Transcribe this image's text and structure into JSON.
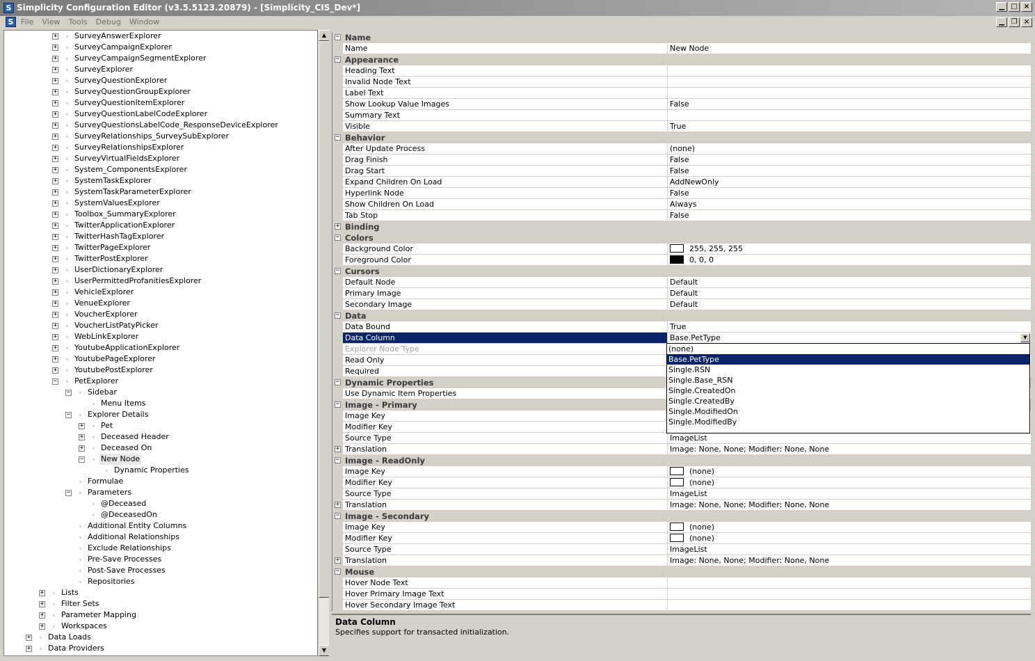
{
  "window": {
    "title": "Simplicity Configuration Editor (v3.5.5123.20879) - [Simplicity_CIS_Dev*]",
    "app_icon": "S",
    "minimize": "▁",
    "maximize": "□",
    "close": "×",
    "restore": "❐"
  },
  "menu": [
    "File",
    "View",
    "Tools",
    "Debug",
    "Window"
  ],
  "tree": [
    {
      "indent": 2,
      "exp": "+",
      "label": "SurveyAnswerExplorer"
    },
    {
      "indent": 2,
      "exp": "+",
      "label": "SurveyCampaignExplorer"
    },
    {
      "indent": 2,
      "exp": "+",
      "label": "SurveyCampaignSegmentExplorer"
    },
    {
      "indent": 2,
      "exp": "+",
      "label": "SurveyExplorer"
    },
    {
      "indent": 2,
      "exp": "+",
      "label": "SurveyQuestionExplorer"
    },
    {
      "indent": 2,
      "exp": "+",
      "label": "SurveyQuestionGroupExplorer"
    },
    {
      "indent": 2,
      "exp": "+",
      "label": "SurveyQuestionItemExplorer"
    },
    {
      "indent": 2,
      "exp": "+",
      "label": "SurveyQuestionLabelCodeExplorer"
    },
    {
      "indent": 2,
      "exp": "+",
      "label": "SurveyQuestionsLabelCode_ResponseDeviceExplorer"
    },
    {
      "indent": 2,
      "exp": "+",
      "label": "SurveyRelationships_SurveySubExplorer"
    },
    {
      "indent": 2,
      "exp": "+",
      "label": "SurveyRelationshipsExplorer"
    },
    {
      "indent": 2,
      "exp": "+",
      "label": "SurveyVirtualFieldsExplorer"
    },
    {
      "indent": 2,
      "exp": "+",
      "label": "System_ComponentsExplorer"
    },
    {
      "indent": 2,
      "exp": "+",
      "label": "SystemTaskExplorer"
    },
    {
      "indent": 2,
      "exp": "+",
      "label": "SystemTaskParameterExplorer"
    },
    {
      "indent": 2,
      "exp": "+",
      "label": "SystemValuesExplorer"
    },
    {
      "indent": 2,
      "exp": "+",
      "label": "Toolbox_SummaryExplorer"
    },
    {
      "indent": 2,
      "exp": "+",
      "label": "TwitterApplicationExplorer"
    },
    {
      "indent": 2,
      "exp": "+",
      "label": "TwitterHashTagExplorer"
    },
    {
      "indent": 2,
      "exp": "+",
      "label": "TwitterPageExplorer"
    },
    {
      "indent": 2,
      "exp": "+",
      "label": "TwitterPostExplorer"
    },
    {
      "indent": 2,
      "exp": "+",
      "label": "UserDictionaryExplorer"
    },
    {
      "indent": 2,
      "exp": "+",
      "label": "UserPermittedProfanitiesExplorer"
    },
    {
      "indent": 2,
      "exp": "+",
      "label": "VehicleExplorer"
    },
    {
      "indent": 2,
      "exp": "+",
      "label": "VenueExplorer"
    },
    {
      "indent": 2,
      "exp": "+",
      "label": "VoucherExplorer"
    },
    {
      "indent": 2,
      "exp": "+",
      "label": "VoucherListPatyPicker"
    },
    {
      "indent": 2,
      "exp": "+",
      "label": "WebLinkExplorer"
    },
    {
      "indent": 2,
      "exp": "+",
      "label": "YoutubeApplicationExplorer"
    },
    {
      "indent": 2,
      "exp": "+",
      "label": "YoutubePageExplorer"
    },
    {
      "indent": 2,
      "exp": "+",
      "label": "YoutubePostExplorer"
    },
    {
      "indent": 2,
      "exp": "−",
      "label": "PetExplorer"
    },
    {
      "indent": 3,
      "exp": "−",
      "label": "Sidebar"
    },
    {
      "indent": 4,
      "exp": "",
      "label": "Menu Items"
    },
    {
      "indent": 3,
      "exp": "−",
      "label": "Explorer Details"
    },
    {
      "indent": 4,
      "exp": "+",
      "label": "Pet"
    },
    {
      "indent": 4,
      "exp": "+",
      "label": "Deceased Header"
    },
    {
      "indent": 4,
      "exp": "+",
      "label": "Deceased On"
    },
    {
      "indent": 4,
      "exp": "−",
      "label": "New Node",
      "selected": true
    },
    {
      "indent": 5,
      "exp": "",
      "label": "Dynamic Properties"
    },
    {
      "indent": 3,
      "exp": "",
      "label": "Formulae"
    },
    {
      "indent": 3,
      "exp": "−",
      "label": "Parameters"
    },
    {
      "indent": 4,
      "exp": "",
      "label": "@Deceased"
    },
    {
      "indent": 4,
      "exp": "",
      "label": "@DeceasedOn"
    },
    {
      "indent": 3,
      "exp": "",
      "label": "Additional Entity Columns"
    },
    {
      "indent": 3,
      "exp": "",
      "label": "Additional Relationships"
    },
    {
      "indent": 3,
      "exp": "",
      "label": "Exclude Relationships"
    },
    {
      "indent": 3,
      "exp": "",
      "label": "Pre-Save Processes"
    },
    {
      "indent": 3,
      "exp": "",
      "label": "Post-Save Processes"
    },
    {
      "indent": 3,
      "exp": "",
      "label": "Repositories"
    },
    {
      "indent": 1,
      "exp": "+",
      "label": "Lists"
    },
    {
      "indent": 1,
      "exp": "+",
      "label": "Filter Sets"
    },
    {
      "indent": 1,
      "exp": "+",
      "label": "Parameter Mapping"
    },
    {
      "indent": 1,
      "exp": "+",
      "label": "Workspaces"
    },
    {
      "indent": 0,
      "exp": "+",
      "label": "Data Loads"
    },
    {
      "indent": 0,
      "exp": "+",
      "label": "Data Providers"
    }
  ],
  "scroll": {
    "up": "▲",
    "down": "▼"
  },
  "grid": [
    {
      "cat": true,
      "exp": "−",
      "name": "Name"
    },
    {
      "name": "Name",
      "value": "New Node"
    },
    {
      "cat": true,
      "exp": "−",
      "name": "Appearance"
    },
    {
      "name": "Heading Text",
      "value": ""
    },
    {
      "name": "Invalid Node Text",
      "value": ""
    },
    {
      "name": "Label Text",
      "value": ""
    },
    {
      "name": "Show Lookup Value Images",
      "value": "False"
    },
    {
      "name": "Summary Text",
      "value": ""
    },
    {
      "name": "Visible",
      "value": "True"
    },
    {
      "cat": true,
      "exp": "−",
      "name": "Behavior"
    },
    {
      "name": "After Update Process",
      "value": "(none)"
    },
    {
      "name": "Drag Finish",
      "value": "False"
    },
    {
      "name": "Drag Start",
      "value": "False"
    },
    {
      "name": "Expand Children On Load",
      "value": "AddNewOnly"
    },
    {
      "name": "Hyperlink Node",
      "value": "False"
    },
    {
      "name": "Show Children On Load",
      "value": "Always"
    },
    {
      "name": "Tab Stop",
      "value": "False"
    },
    {
      "cat": true,
      "exp": "+",
      "name": "Binding"
    },
    {
      "cat": true,
      "exp": "−",
      "name": "Colors"
    },
    {
      "name": "Background Color",
      "value": "255, 255, 255",
      "swatch": "#ffffff"
    },
    {
      "name": "Foreground Color",
      "value": "0, 0, 0",
      "swatch": "#000000"
    },
    {
      "cat": true,
      "exp": "−",
      "name": "Cursors"
    },
    {
      "name": "Default Node",
      "value": "Default"
    },
    {
      "name": "Primary Image",
      "value": "Default"
    },
    {
      "name": "Secondary Image",
      "value": "Default"
    },
    {
      "cat": true,
      "exp": "−",
      "name": "Data"
    },
    {
      "name": "Data Bound",
      "value": "True"
    },
    {
      "name": "Data Column",
      "value": "Base.PetType",
      "selected": true,
      "dropdown": true
    },
    {
      "name": "Explorer Node Type",
      "value": "",
      "disabled": true
    },
    {
      "name": "Read Only",
      "value": ""
    },
    {
      "name": "Required",
      "value": ""
    },
    {
      "cat": true,
      "exp": "−",
      "name": "Dynamic Properties"
    },
    {
      "name": "Use Dynamic Item Properties",
      "value": ""
    },
    {
      "cat": true,
      "exp": "−",
      "name": "Image - Primary"
    },
    {
      "name": "Image Key",
      "value": ""
    },
    {
      "name": "Modifier Key",
      "value": ""
    },
    {
      "name": "Source Type",
      "value": "ImageList"
    },
    {
      "name": "Translation",
      "value": "Image: None, None; Modifier: None, None",
      "exp": "+"
    },
    {
      "cat": true,
      "exp": "−",
      "name": "Image - ReadOnly"
    },
    {
      "name": "Image Key",
      "value": "(none)",
      "swatch": "#ffffff"
    },
    {
      "name": "Modifier Key",
      "value": "(none)",
      "swatch": "#ffffff"
    },
    {
      "name": "Source Type",
      "value": "ImageList"
    },
    {
      "name": "Translation",
      "value": "Image: None, None; Modifier: None, None",
      "exp": "+"
    },
    {
      "cat": true,
      "exp": "−",
      "name": "Image - Secondary"
    },
    {
      "name": "Image Key",
      "value": "(none)",
      "swatch": "#ffffff"
    },
    {
      "name": "Modifier Key",
      "value": "(none)",
      "swatch": "#ffffff"
    },
    {
      "name": "Source Type",
      "value": "ImageList"
    },
    {
      "name": "Translation",
      "value": "Image: None, None; Modifier: None, None",
      "exp": "+"
    },
    {
      "cat": true,
      "exp": "−",
      "name": "Mouse"
    },
    {
      "name": "Hover Node Text",
      "value": ""
    },
    {
      "name": "Hover Primary Image Text",
      "value": ""
    },
    {
      "name": "Hover Secondary Image Text",
      "value": ""
    }
  ],
  "dropdown": {
    "arrow": "▼",
    "options": [
      "(none)",
      "Base.PetType",
      "Single.RSN",
      "Single.Base_RSN",
      "Single.CreatedOn",
      "Single.CreatedBy",
      "Single.ModifiedOn",
      "Single.ModifiedBy"
    ],
    "selected_index": 1
  },
  "description": {
    "title": "Data Column",
    "text": "Specifies support for transacted initialization."
  }
}
